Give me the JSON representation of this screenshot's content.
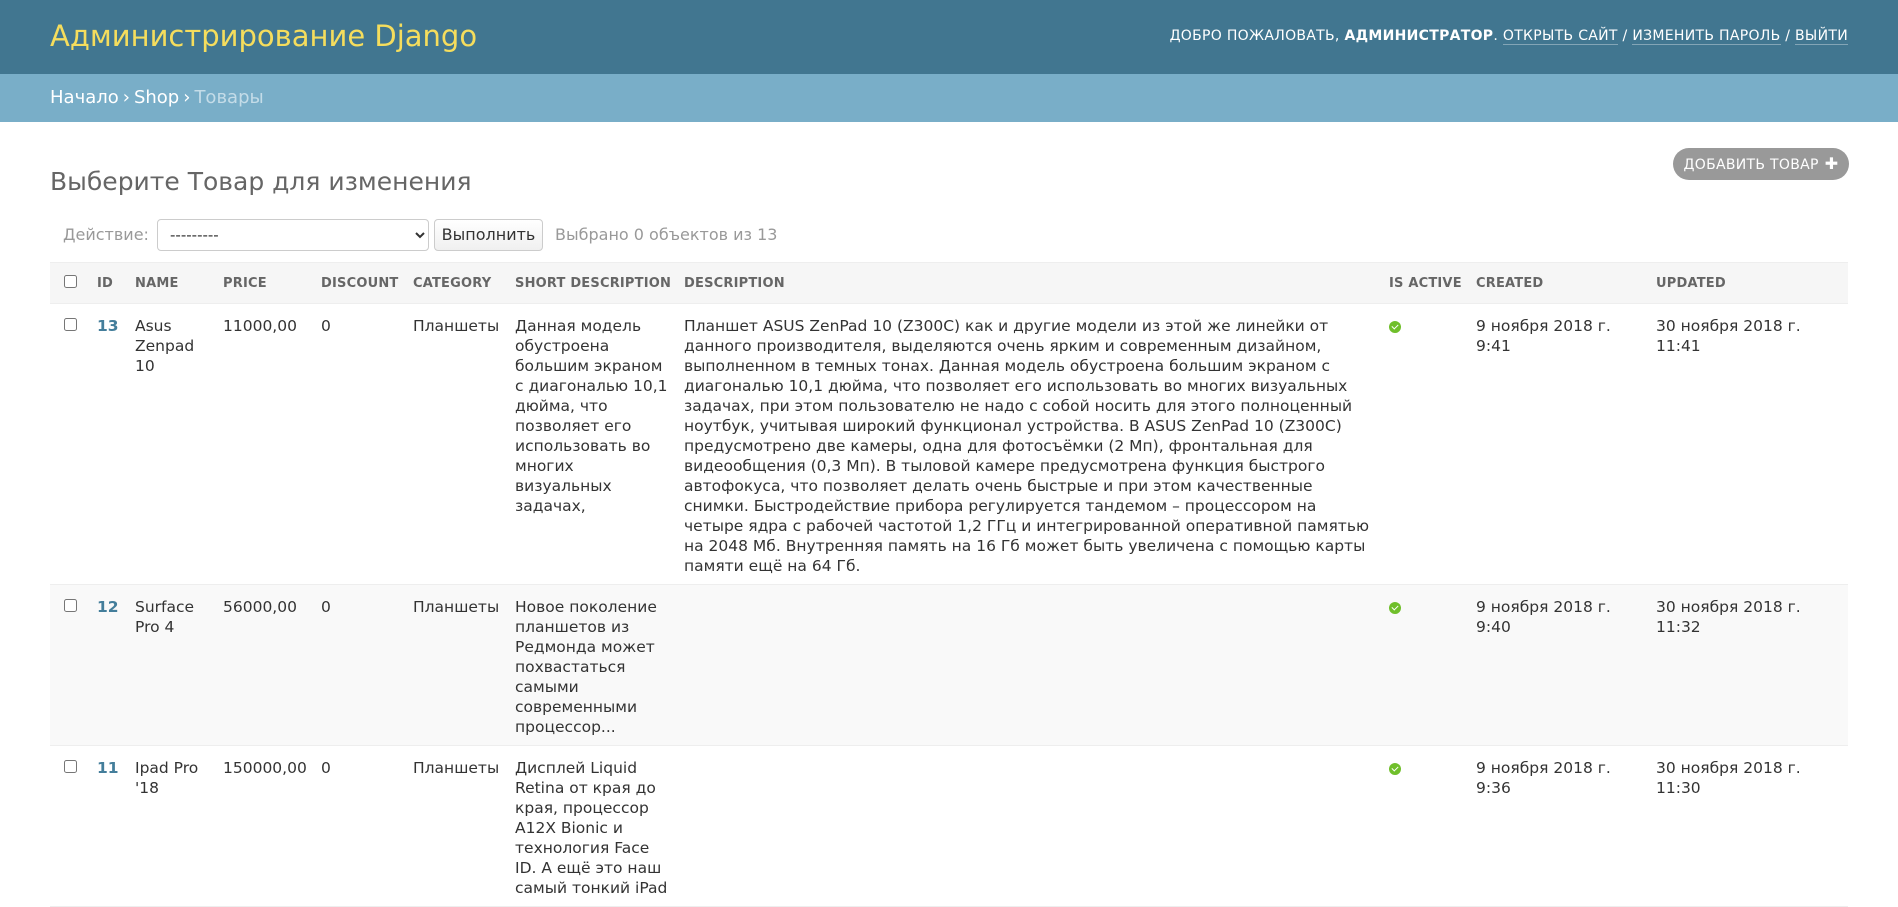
{
  "header": {
    "brand": "Администрирование Django",
    "welcome": "ДОБРО ПОЖАЛОВАТЬ,",
    "user": "АДМИНИСТРАТОР",
    "view_site": "ОТКРЫТЬ САЙТ",
    "change_password": "ИЗМЕНИТЬ ПАРОЛЬ",
    "logout": "ВЫЙТИ"
  },
  "breadcrumbs": {
    "home": "Начало",
    "app": "Shop",
    "current": "Товары"
  },
  "page": {
    "title": "Выберите Товар для изменения",
    "add_button": "ДОБАВИТЬ ТОВАР"
  },
  "actions": {
    "label": "Действие:",
    "select_value": "---------",
    "go_button": "Выполнить",
    "counter": "Выбрано 0 объектов из 13"
  },
  "table": {
    "columns": [
      "ID",
      "NAME",
      "PRICE",
      "DISCOUNT",
      "CATEGORY",
      "SHORT DESCRIPTION",
      "DESCRIPTION",
      "IS ACTIVE",
      "CREATED",
      "UPDATED"
    ],
    "rows": [
      {
        "id": "13",
        "name": "Asus Zenpad 10",
        "price": "11000,00",
        "discount": "0",
        "category": "Планшеты",
        "short_description": "Данная модель обустроена большим экраном с диагональю 10,1 дюйма, что позволяет его использовать во многих визуальных задачах,",
        "description": "Планшет ASUS ZenPad 10 (Z300C) как и другие модели из этой же линейки от данного производителя, выделяются очень ярким и современным дизайном, выполненном в темных тонах. Данная модель обустроена большим экраном с диагональю 10,1 дюйма, что позволяет его использовать во многих визуальных задачах, при этом пользователю не надо с собой носить для этого полноценный ноутбук, учитывая широкий функционал устройства. В ASUS ZenPad 10 (Z300C) предусмотрено две камеры, одна для фотосъёмки (2 Мп), фронтальная для видеообщения (0,3 Мп). В тыловой камере предусмотрена функция быстрого автофокуса, что позволяет делать очень быстрые и при этом качественные снимки. Быстродействие прибора регулируется тандемом – процессором на четыре ядра с рабочей частотой 1,2 ГГц и интегрированной оперативной памятью на 2048 Мб. Внутренняя память на 16 Гб может быть увеличена с помощью карты памяти ещё на 64 Гб.",
        "is_active": true,
        "created": "9 ноября 2018 г. 9:41",
        "updated": "30 ноября 2018 г. 11:41"
      },
      {
        "id": "12",
        "name": "Surface Pro 4",
        "price": "56000,00",
        "discount": "0",
        "category": "Планшеты",
        "short_description": "Новое поколение планшетов из Редмонда может похвастаться самыми современными процессор...",
        "description": "",
        "is_active": true,
        "created": "9 ноября 2018 г. 9:40",
        "updated": "30 ноября 2018 г. 11:32"
      },
      {
        "id": "11",
        "name": "Ipad Pro '18",
        "price": "150000,00",
        "discount": "0",
        "category": "Планшеты",
        "short_description": "Дисплей Liquid Retina от края до края, процессор A12X Bionic и технология Face ID. А ещё это наш самый тонкий iPad",
        "description": "",
        "is_active": true,
        "created": "9 ноября 2018 г. 9:36",
        "updated": "30 ноября 2018 г. 11:30"
      }
    ]
  },
  "colors": {
    "header_bg": "#417690",
    "brand": "#f5dd5d",
    "breadcrumbs_bg": "#79aec8",
    "link": "#447e9b",
    "active": "#70bf2b"
  }
}
